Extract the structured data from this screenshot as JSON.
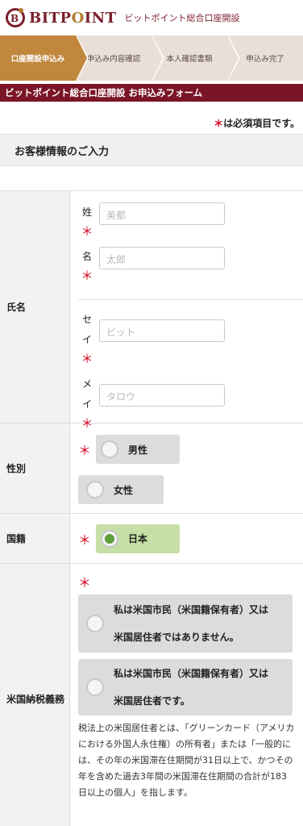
{
  "header": {
    "brand_main": "BITP",
    "brand_o": "O",
    "brand_tail": "INT",
    "tagline": "ビットポイント総合口座開設"
  },
  "steps": [
    {
      "label": "口座開設申込み",
      "active": true
    },
    {
      "label": "申込み内容確認",
      "active": false
    },
    {
      "label": "本人確認書類",
      "active": false
    },
    {
      "label": "申込み完了",
      "active": false
    }
  ],
  "form_bar": "ビットポイント総合口座開設 お申込みフォーム",
  "required_note": {
    "star": "＊",
    "text": "は必須項目です。"
  },
  "section_title": "お客様情報のご入力",
  "fields": {
    "name": {
      "label": "氏名",
      "sei_label": "姓",
      "sei_placeholder": "美都",
      "mei_label": "名",
      "mei_placeholder": "太郎",
      "sei_kana_label_1": "セ",
      "sei_kana_label_2": "イ",
      "sei_kana_placeholder": "ビット",
      "mei_kana_label_1": "メ",
      "mei_kana_label_2": "イ",
      "mei_kana_placeholder": "タロウ"
    },
    "gender": {
      "label": "性別",
      "options": [
        "男性",
        "女性"
      ]
    },
    "nationality": {
      "label": "国籍",
      "selected": "日本"
    },
    "us_tax": {
      "label": "米国納税義務",
      "option1_line1": "私は米国市民（米国籍保有者）又は",
      "option1_line2": "米国居住者ではありません。",
      "option2_line1": "私は米国市民（米国籍保有者）又は",
      "option2_line2": "米国居住者です。",
      "note": "税法上の米国居住者とは、「グリーンカード（アメリカにおける外国人永住権）の所有者」または「一般的には、その年の米国滞在住期間が31日以上で、かつその年を含めた過去3年間の米国滞在住期間の合計が183日以上の個人」を指します。"
    }
  },
  "required_star": "＊",
  "colors": {
    "brand": "#7a1526",
    "step_active": "#c1873d",
    "selected_option": "#c6dfa6"
  }
}
